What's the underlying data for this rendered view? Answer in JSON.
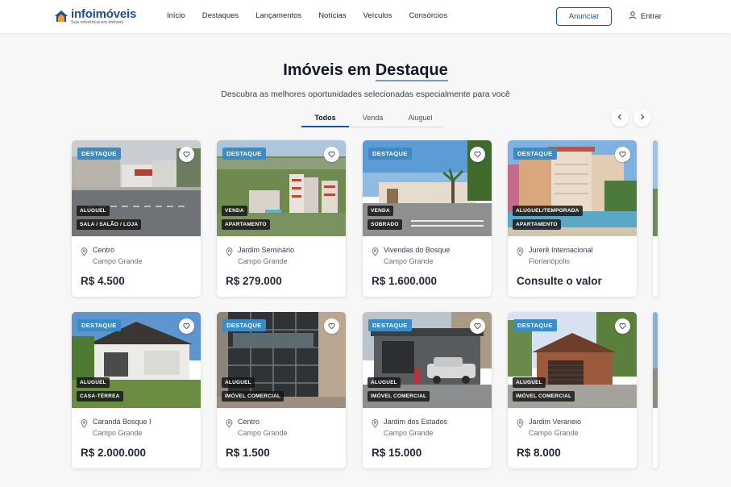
{
  "header": {
    "logo_name": "infoimóveis",
    "logo_tagline": "Sua referência em imóveis",
    "nav": [
      "Início",
      "Destaques",
      "Lançamentos",
      "Notícias",
      "Veículos",
      "Consórcios"
    ],
    "cta_label": "Anunciar",
    "login_label": "Entrar"
  },
  "hero": {
    "title_prefix": "Imóveis em ",
    "title_highlight": "Destaque",
    "subtitle": "Descubra as melhores oportunidades selecionadas especialmente para você"
  },
  "tabs": [
    {
      "label": "Todos",
      "active": true
    },
    {
      "label": "Venda",
      "active": false
    },
    {
      "label": "Aluguel",
      "active": false
    }
  ],
  "carousel": {
    "prev_icon": "chevron-left-icon",
    "next_icon": "chevron-right-icon"
  },
  "listings": [
    {
      "badge": "DESTAQUE",
      "tags": [
        "ALUGUEL",
        "SALA / SALÃO / LOJA"
      ],
      "neighborhood": "Centro",
      "city": "Campo Grande",
      "price": "R$ 4.500",
      "scene": "street"
    },
    {
      "badge": "DESTAQUE",
      "tags": [
        "VENDA",
        "APARTAMENTO"
      ],
      "neighborhood": "Jardim Seminário",
      "city": "Campo Grande",
      "price": "R$ 279.000",
      "scene": "aerial"
    },
    {
      "badge": "DESTAQUE",
      "tags": [
        "VENDA",
        "SOBRADO"
      ],
      "neighborhood": "Vivendas do Bosque",
      "city": "Campo Grande",
      "price": "R$ 1.600.000",
      "scene": "palms"
    },
    {
      "badge": "DESTAQUE",
      "tags": [
        "ALUGUEL/TEMPORADA",
        "APARTAMENTO"
      ],
      "neighborhood": "Jurerê Internacional",
      "city": "Florianópolis",
      "price": "Consulte o valor",
      "scene": "resort"
    },
    {
      "badge": "DESTAQUE",
      "tags": [
        "ALUGUEL",
        "CASA-TÉRREA"
      ],
      "neighborhood": "Carandá Bosque I",
      "city": "Campo Grande",
      "price": "R$ 2.000.000",
      "scene": "house"
    },
    {
      "badge": "DESTAQUE",
      "tags": [
        "ALUGUEL",
        "IMÓVEL COMERCIAL"
      ],
      "neighborhood": "Centro",
      "city": "Campo Grande",
      "price": "R$ 1.500",
      "scene": "glass"
    },
    {
      "badge": "DESTAQUE",
      "tags": [
        "ALUGUEL",
        "IMÓVEL COMERCIAL"
      ],
      "neighborhood": "Jardim dos Estados",
      "city": "Campo Grande",
      "price": "R$ 15.000",
      "scene": "garage"
    },
    {
      "badge": "DESTAQUE",
      "tags": [
        "ALUGUEL",
        "IMÓVEL COMERCIAL"
      ],
      "neighborhood": "Jardim Veraneio",
      "city": "Campo Grande",
      "price": "R$ 8.000",
      "scene": "brick"
    }
  ]
}
